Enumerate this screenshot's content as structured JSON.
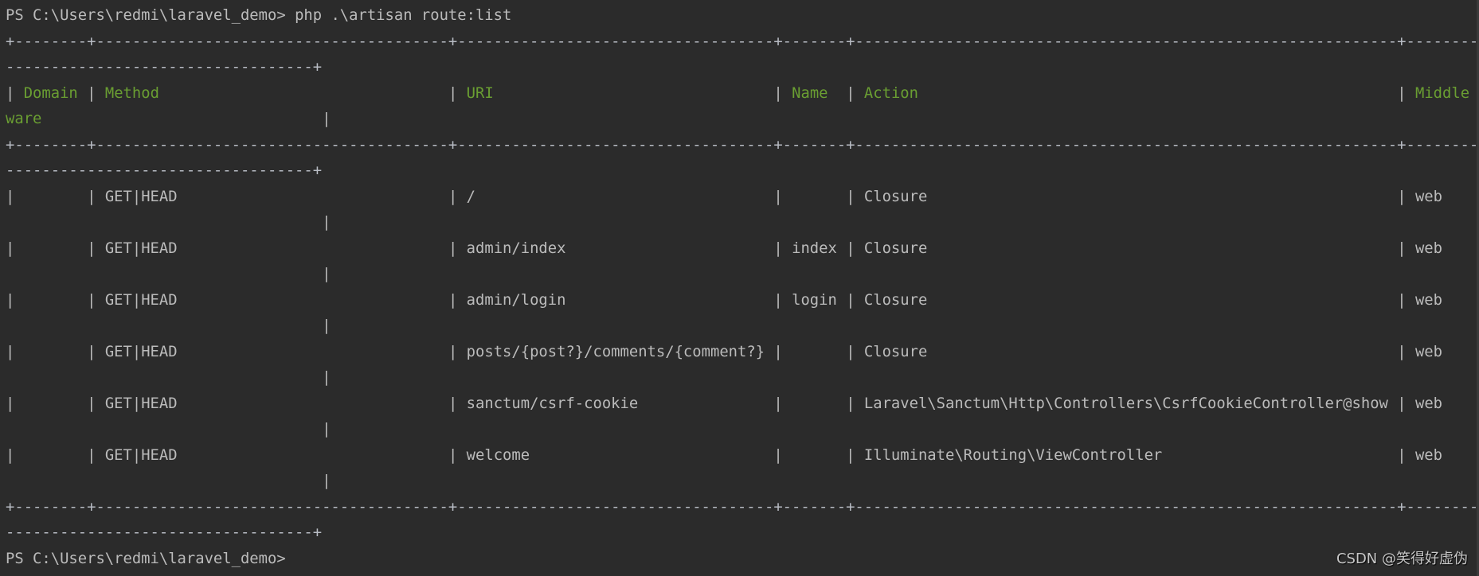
{
  "terminal": {
    "prompt": "PS C:\\Users\\redmi\\laravel_demo>",
    "command": "php .\\artisan route:list",
    "colors": {
      "background": "#2b2b2b",
      "text": "#bbbbbb",
      "header": "#6a9e32"
    }
  },
  "table": {
    "headers": [
      "Domain",
      "Method",
      "URI",
      "Name",
      "Action",
      "Middleware"
    ],
    "rows": [
      [
        "",
        "GET|HEAD",
        "/",
        "",
        "Closure",
        "web"
      ],
      [
        "",
        "GET|HEAD",
        "admin/index",
        "index",
        "Closure",
        "web"
      ],
      [
        "",
        "GET|HEAD",
        "admin/login",
        "login",
        "Closure",
        "web"
      ],
      [
        "",
        "GET|HEAD",
        "posts/{post?}/comments/{comment?}",
        "",
        "Closure",
        "web"
      ],
      [
        "",
        "GET|HEAD",
        "sanctum/csrf-cookie",
        "",
        "Laravel\\Sanctum\\Http\\Controllers\\CsrfCookieController@show",
        "web"
      ],
      [
        "",
        "GET|HEAD",
        "welcome",
        "",
        "Illuminate\\Routing\\ViewController",
        "web"
      ]
    ]
  },
  "watermark": "CSDN @笑得好虚伪"
}
